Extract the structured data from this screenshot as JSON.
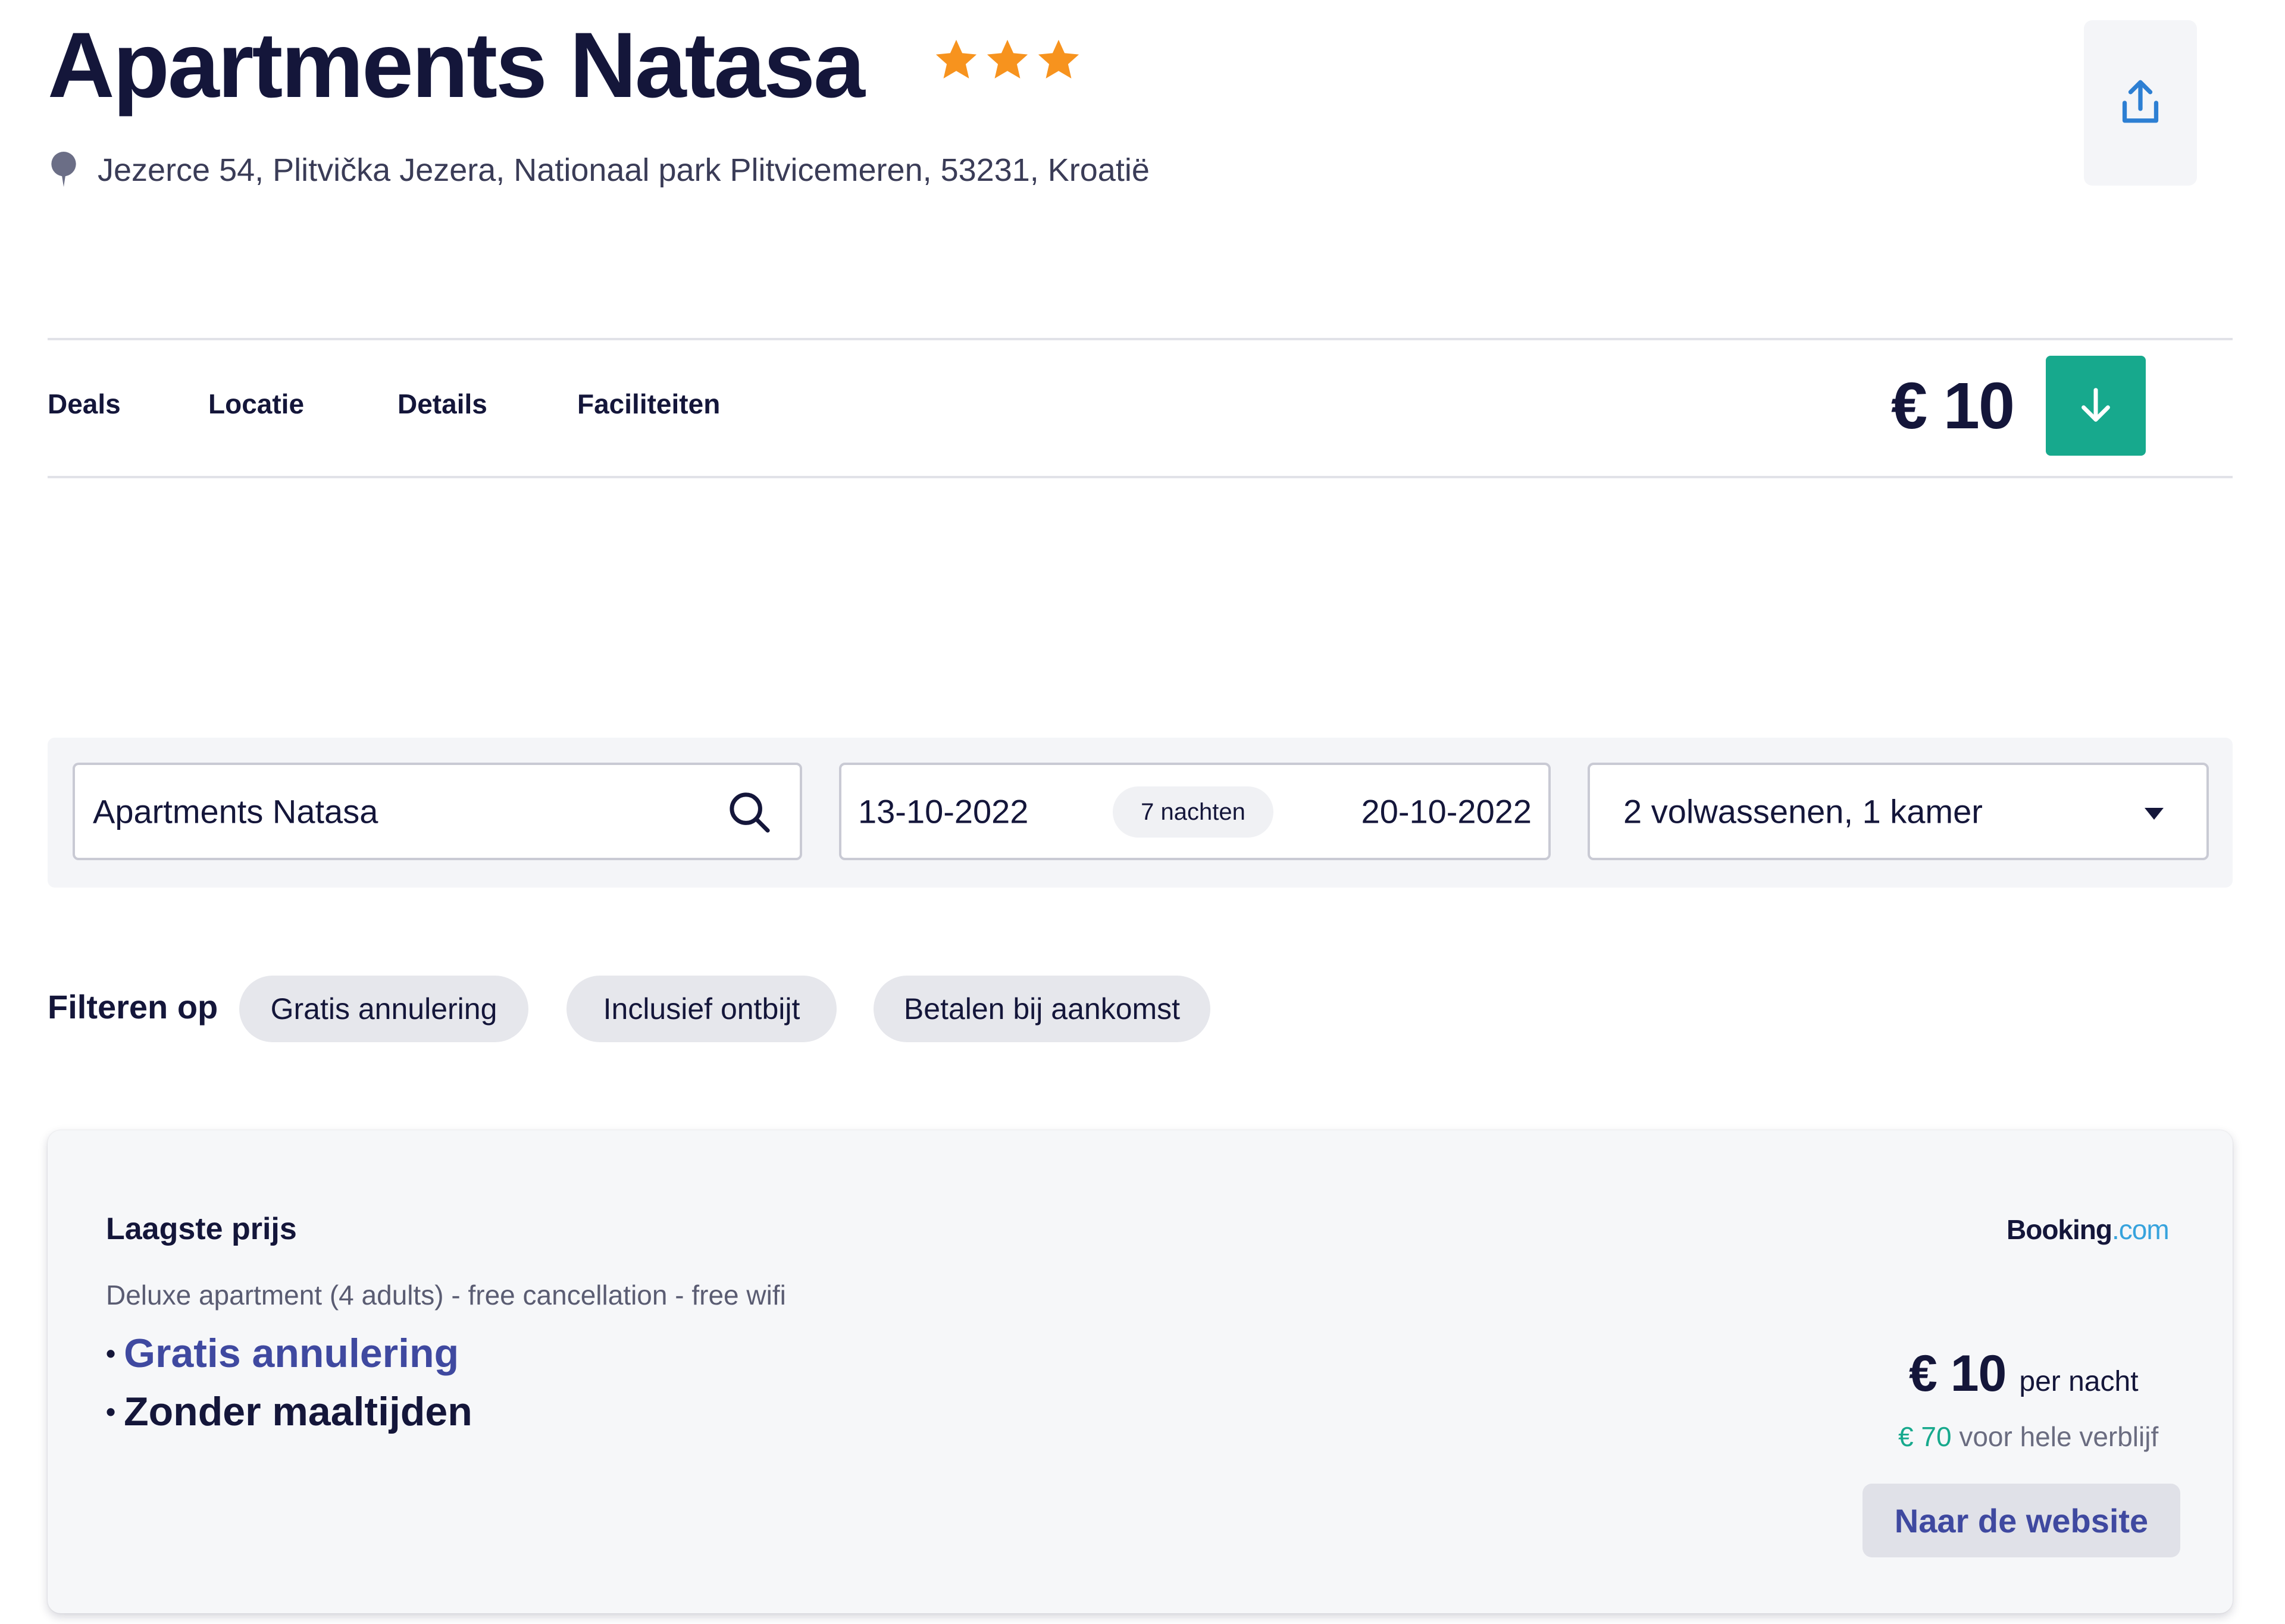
{
  "header": {
    "title": "Apartments Natasa",
    "star_count": 3,
    "star_color": "#f7931e",
    "address": "Jezerce 54, Plitvička Jezera, Nationaal park Plitvicemeren, 53231, Kroatië",
    "address_icon": "map-pin-icon",
    "share_icon": "share-upload-icon"
  },
  "nav": {
    "tabs": [
      "Deals",
      "Locatie",
      "Details",
      "Faciliteiten"
    ],
    "price": "€ 10",
    "scroll_icon": "arrow-down-icon",
    "accent": "#17a98d"
  },
  "search": {
    "hotel_value": "Apartments Natasa",
    "search_icon": "search-icon",
    "checkin": "13-10-2022",
    "nights": "7 nachten",
    "checkout": "20-10-2022",
    "guests": "2 volwassenen, 1 kamer",
    "guests_icon": "caret-down-icon"
  },
  "filters": {
    "label": "Filteren op",
    "chips": [
      "Gratis annulering",
      "Inclusief ontbijt",
      "Betalen bij aankomst"
    ]
  },
  "deal": {
    "title": "Laagste prijs",
    "provider_name": "Booking",
    "provider_suffix": ".com",
    "description": "Deluxe apartment (4 adults) - free cancellation - free wifi",
    "features": [
      "Gratis annulering",
      "Zonder maaltijden"
    ],
    "price": "€ 10",
    "price_unit": "per nacht",
    "total_amount": "€ 70",
    "total_label": "voor hele verblijf",
    "cta": "Naar de website"
  }
}
